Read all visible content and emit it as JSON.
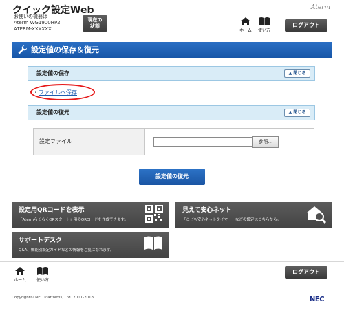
{
  "header": {
    "app_title": "クイック設定Web",
    "device_label_line1": "お使いの機器は",
    "device_label_line2": "Aterm WG1900HP2",
    "device_label_line3": "ATERM-XXXXXX",
    "status_button_line1": "現在の",
    "status_button_line2": "状態",
    "brand": "Aterm",
    "home_label": "ホーム",
    "manual_label": "使い方",
    "logout_label": "ログアウト"
  },
  "section": {
    "title": "設定値の保存＆復元"
  },
  "save_panel": {
    "title": "設定値の保存",
    "close_label": "閉じる",
    "link_bullet": "・",
    "link_label": "ファイルへ保存"
  },
  "restore_panel": {
    "title": "設定値の復元",
    "close_label": "閉じる",
    "file_label": "設定ファイル",
    "file_input_value": "",
    "browse_label": "参照...",
    "restore_button": "設定値の復元"
  },
  "tiles": {
    "qr_title": "設定用QRコードを表示",
    "qr_desc": "「AtermらくらくQRスタート」用のQRコードを作成できます。",
    "safety_title": "見えて安心ネット",
    "safety_desc": "「こども安心ネットタイマー」などの設定はこちらから。",
    "support_title": "サポートデスク",
    "support_desc": "Q&A、機能別設定ガイドなどの情報をご覧になれます。"
  },
  "footer": {
    "home_label": "ホーム",
    "manual_label": "使い方",
    "logout_label": "ログアウト",
    "copyright": "Copyright© NEC Platforms, Ltd. 2001-2018",
    "nec": "NEC"
  },
  "colors": {
    "accent_blue": "#1756a8",
    "highlight_red": "#e61919",
    "tile_gray": "#4f4f4f"
  }
}
